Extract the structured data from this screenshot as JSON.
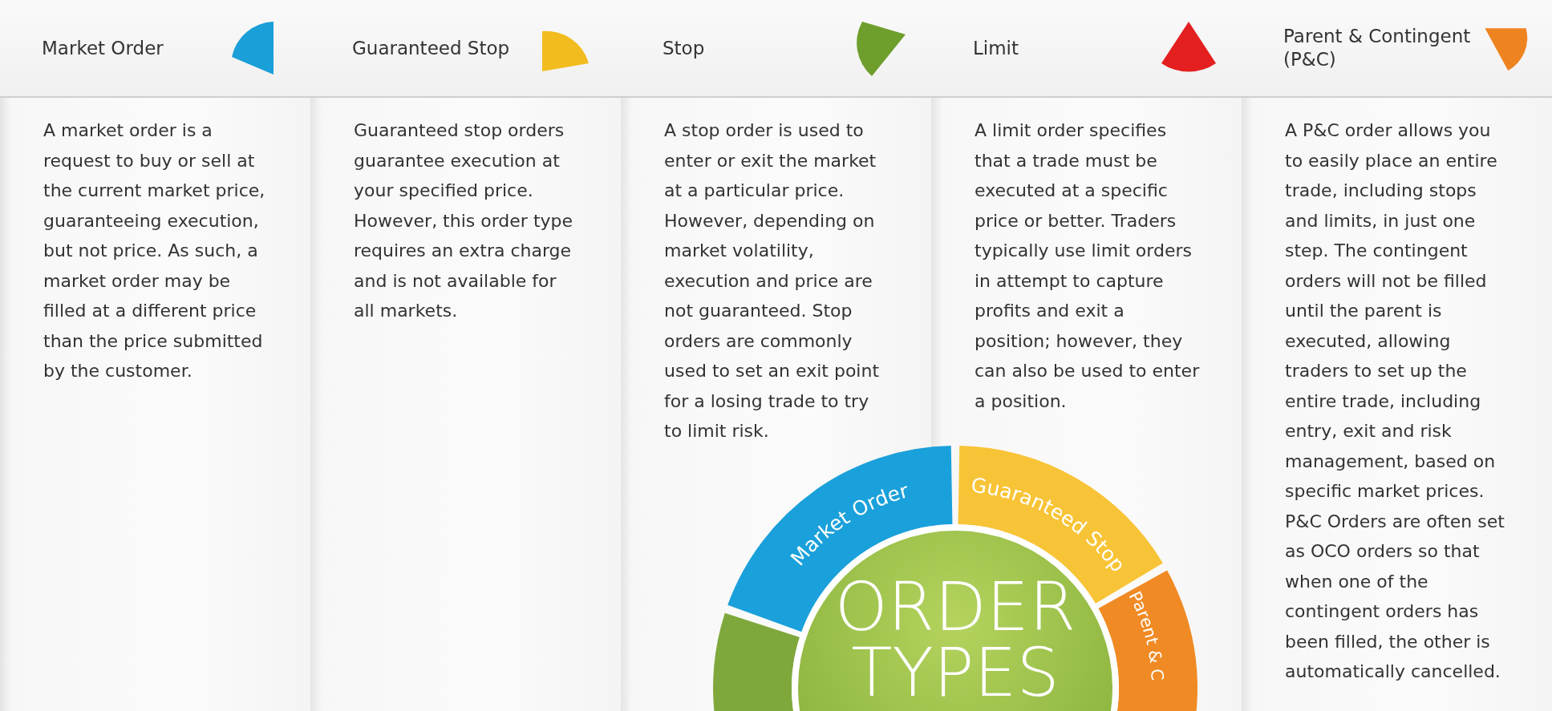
{
  "columns": [
    {
      "title": "Market Order",
      "color": "#1a9fd8",
      "text": "A market order is a request to buy or sell at the current market price, guaranteeing execution, but not price. As such, a market order may be filled at a different price than the price submitted by the customer."
    },
    {
      "title": "Guaranteed Stop",
      "color": "#f2bc1e",
      "text": "Guaranteed stop orders guarantee execution at your specified price. However, this order type requires an extra charge and is not available for all markets."
    },
    {
      "title": "Stop",
      "color": "#6e9e2c",
      "text": "A stop order is used to enter or exit the market at a particular price. However, depending on market volatility, execution and price are not guaranteed. Stop orders are commonly used to set an exit point for a losing trade to try to limit risk."
    },
    {
      "title": "Limit",
      "color": "#e3201f",
      "text": "A limit order specifies that a trade must be executed at a specific price or better. Traders typically use limit orders in attempt to capture profits and exit a position; however, they can also be used to enter a position."
    },
    {
      "title": "Parent & Contingent (P&C)",
      "color": "#ee8420",
      "text": "A P&C order allows you to easily place an entire trade, including stops and limits, in just one step. The contingent orders will not be filled until the parent is executed, allowing traders to set up the entire trade, including entry, exit and risk management, based on specific market prices. P&C Orders are often set as OCO orders so that when one of the contingent orders has been filled, the other is automatically cancelled."
    }
  ],
  "wheel": {
    "center_lines": [
      "ORDER",
      "TYPES"
    ],
    "segments": [
      {
        "label": "Market Order",
        "color": "#1aa0da"
      },
      {
        "label": "Guaranteed Stop",
        "color": "#f8c437"
      },
      {
        "label": "Parent & C",
        "color": "#f08a24"
      },
      {
        "color": "#7fa83c"
      }
    ]
  }
}
